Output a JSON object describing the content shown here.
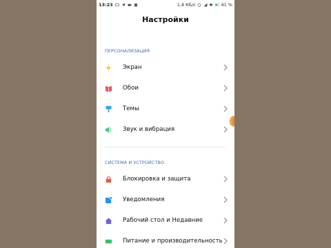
{
  "status_bar": {
    "time": "13:23",
    "net_speed": "1,4 КБ/с",
    "battery": "41 %",
    "left_icons": [
      "message-icon",
      "telegram-icon",
      "video-icon",
      "trash-icon"
    ],
    "right_icons": [
      "alarm-icon",
      "signal-icon",
      "wifi-icon",
      "battery-icon"
    ]
  },
  "header": {
    "title": "Настройки"
  },
  "sections": [
    {
      "title": "ПЕРСОНАЛИЗАЦИЯ",
      "items": [
        {
          "label": "Экран",
          "icon": "sun-icon",
          "color": "#f5c542"
        },
        {
          "label": "Обои",
          "icon": "wallpaper-icon",
          "color": "#e05a63"
        },
        {
          "label": "Темы",
          "icon": "brush-icon",
          "color": "#3aa4dd"
        },
        {
          "label": "Звук и вибрация",
          "icon": "speaker-icon",
          "color": "#45c37a"
        }
      ]
    },
    {
      "title": "СИСТЕМА И УСТРОЙСТВО",
      "items": [
        {
          "label": "Блокировка и защита",
          "icon": "lock-icon",
          "color": "#e4564d"
        },
        {
          "label": "Уведомления",
          "icon": "notification-icon",
          "color": "#2a92e8"
        },
        {
          "label": "Рабочий стол и Недавние",
          "icon": "home-icon",
          "color": "#6d63d8"
        },
        {
          "label": "Питание и производительность",
          "icon": "battery-icon",
          "color": "#3dbb6d"
        }
      ]
    }
  ],
  "colors": {
    "background": "#857565",
    "section_title": "#3f6db4",
    "scroll_indicator": "#f1a356"
  }
}
